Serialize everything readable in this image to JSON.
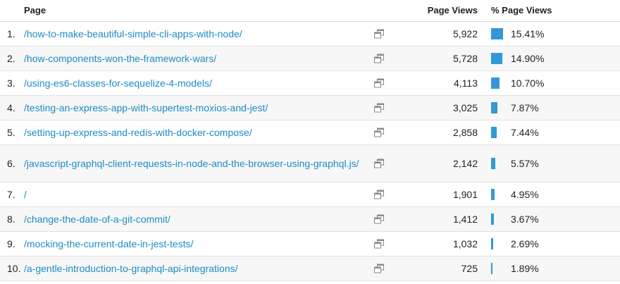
{
  "header": {
    "page": "Page",
    "page_views": "Page Views",
    "pct_page_views": "% Page Views"
  },
  "colors": {
    "link": "#1d8bc4",
    "bar": "#3399d6",
    "row_alt_bg": "#f7f7f7"
  },
  "icons": {
    "row_action": "open-in-new-window-icon"
  },
  "rows": [
    {
      "rank": "1.",
      "page": "/how-to-make-beautiful-simple-cli-apps-with-node/",
      "views": "5,922",
      "pct": "15.41%",
      "share": 15.41
    },
    {
      "rank": "2.",
      "page": "/how-components-won-the-framework-wars/",
      "views": "5,728",
      "pct": "14.90%",
      "share": 14.9
    },
    {
      "rank": "3.",
      "page": "/using-es6-classes-for-sequelize-4-models/",
      "views": "4,113",
      "pct": "10.70%",
      "share": 10.7
    },
    {
      "rank": "4.",
      "page": "/testing-an-express-app-with-supertest-moxios-and-jest/",
      "views": "3,025",
      "pct": "7.87%",
      "share": 7.87
    },
    {
      "rank": "5.",
      "page": "/setting-up-express-and-redis-with-docker-compose/",
      "views": "2,858",
      "pct": "7.44%",
      "share": 7.44
    },
    {
      "rank": "6.",
      "page": "/javascript-graphql-client-requests-in-node-and-the-browser-using-graphql.js/",
      "views": "2,142",
      "pct": "5.57%",
      "share": 5.57
    },
    {
      "rank": "7.",
      "page": "/",
      "views": "1,901",
      "pct": "4.95%",
      "share": 4.95
    },
    {
      "rank": "8.",
      "page": "/change-the-date-of-a-git-commit/",
      "views": "1,412",
      "pct": "3.67%",
      "share": 3.67
    },
    {
      "rank": "9.",
      "page": "/mocking-the-current-date-in-jest-tests/",
      "views": "1,032",
      "pct": "2.69%",
      "share": 2.69
    },
    {
      "rank": "10.",
      "page": "/a-gentle-introduction-to-graphql-api-integrations/",
      "views": "725",
      "pct": "1.89%",
      "share": 1.89
    }
  ]
}
